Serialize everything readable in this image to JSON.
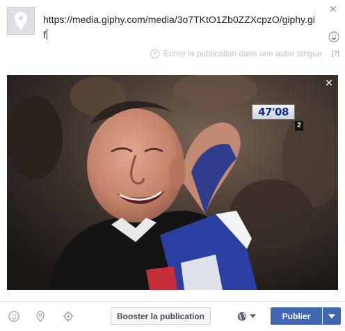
{
  "composer": {
    "text_line1": "https://media.giphy.com/media/3o7TKtO1Zb0ZZXcpzO/giphy.gi",
    "text_line2": "f",
    "translate_label": "Écrire la publication dans une autre langue",
    "help_label": "[?]"
  },
  "preview": {
    "score_clock": "47'08",
    "score_period": "2"
  },
  "footer": {
    "boost_label": "Booster la publication",
    "publish_label": "Publier"
  },
  "colors": {
    "primary": "#4267b2",
    "muted": "#90949c"
  },
  "icons": {
    "avatar": "location-pin-icon",
    "close": "close-icon",
    "emoji": "smiley-icon",
    "plus": "plus-circle-icon",
    "location": "location-pin-icon",
    "target": "crosshair-icon",
    "audience": "globe-icon",
    "dropdown": "chevron-down-icon"
  }
}
